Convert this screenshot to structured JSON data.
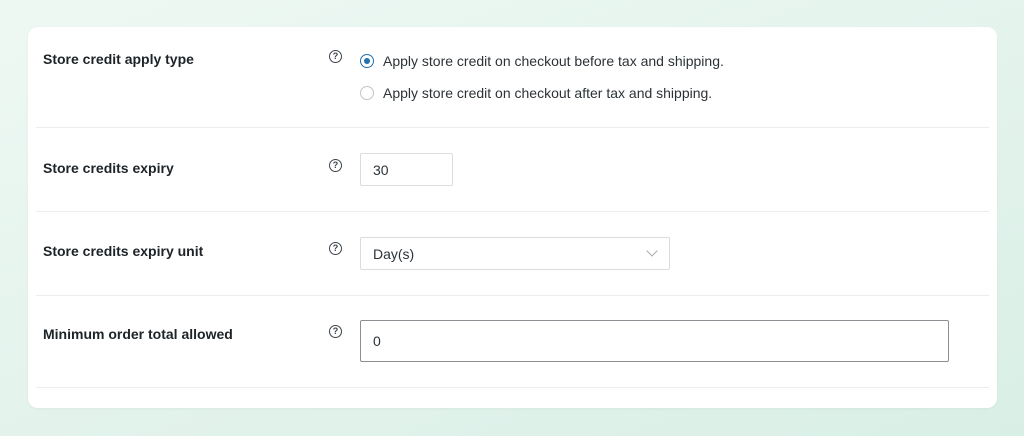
{
  "settings": {
    "apply_type": {
      "label": "Store credit apply type",
      "help_icon": "question-circle-icon",
      "help_glyph": "?",
      "options": [
        {
          "label": "Apply store credit on checkout before tax and shipping.",
          "checked": true
        },
        {
          "label": "Apply store credit on checkout after tax and shipping.",
          "checked": false
        }
      ]
    },
    "expiry": {
      "label": "Store credits expiry",
      "help_glyph": "?",
      "value": "30"
    },
    "expiry_unit": {
      "label": "Store credits expiry unit",
      "help_glyph": "?",
      "selected": "Day(s)"
    },
    "min_order": {
      "label": "Minimum order total allowed",
      "help_glyph": "?",
      "value": "0"
    }
  },
  "colors": {
    "accent": "#2271b1",
    "background": "#e3f3ec"
  }
}
